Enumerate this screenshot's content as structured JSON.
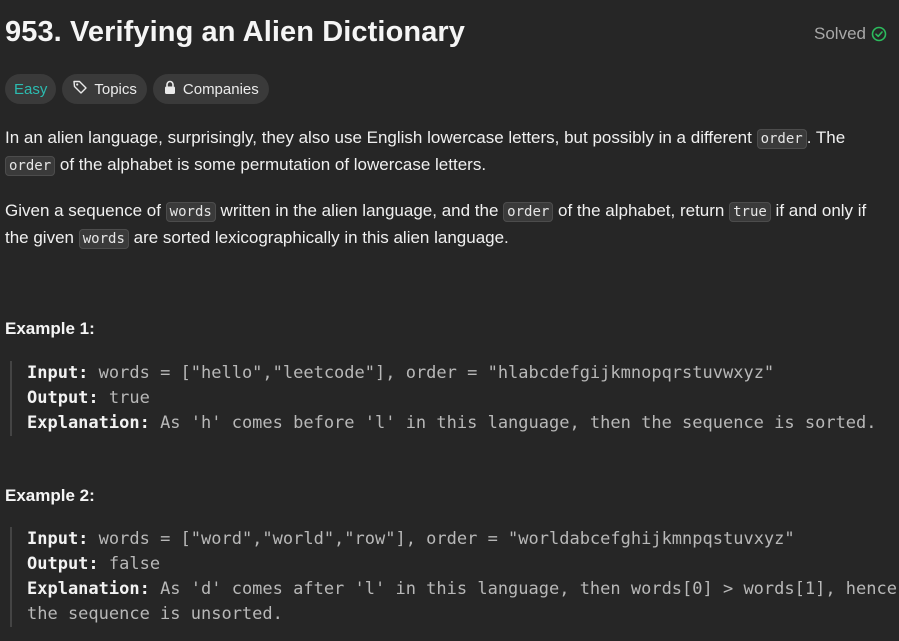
{
  "problem": {
    "title": "953. Verifying an Alien Dictionary",
    "status": "Solved",
    "status_icon": "check-circle-icon",
    "status_color": "#2cbb5d"
  },
  "tags": {
    "difficulty": "Easy",
    "difficulty_color": "#2cbbb0",
    "topics": "Topics",
    "companies": "Companies"
  },
  "description": {
    "p1": {
      "t1": "In an alien language, surprisingly, they also use English lowercase letters, but possibly in a different ",
      "c1": "order",
      "t2": ". The ",
      "c2": "order",
      "t3": " of the alphabet is some permutation of lowercase letters."
    },
    "p2": {
      "t1": "Given a sequence of ",
      "c1": "words",
      "t2": " written in the alien language, and the ",
      "c2": "order",
      "t3": " of the alphabet, return ",
      "c3": "true",
      "t4": " if and only if the given ",
      "c4": "words",
      "t5": " are sorted lexicographically in this alien language."
    }
  },
  "examples": [
    {
      "title": "Example 1:",
      "input_label": "Input:",
      "input": " words = [\"hello\",\"leetcode\"], order = \"hlabcdefgijkmnopqrstuvwxyz\"",
      "output_label": "Output:",
      "output": " true",
      "explanation_label": "Explanation:",
      "explanation": " As 'h' comes before 'l' in this language, then the sequence is sorted."
    },
    {
      "title": "Example 2:",
      "input_label": "Input:",
      "input": " words = [\"word\",\"world\",\"row\"], order = \"worldabcefghijkmnpqstuvxyz\"",
      "output_label": "Output:",
      "output": " false",
      "explanation_label": "Explanation:",
      "explanation": " As 'd' comes after 'l' in this language, then words[0] > words[1], hence the sequence is unsorted."
    }
  ]
}
